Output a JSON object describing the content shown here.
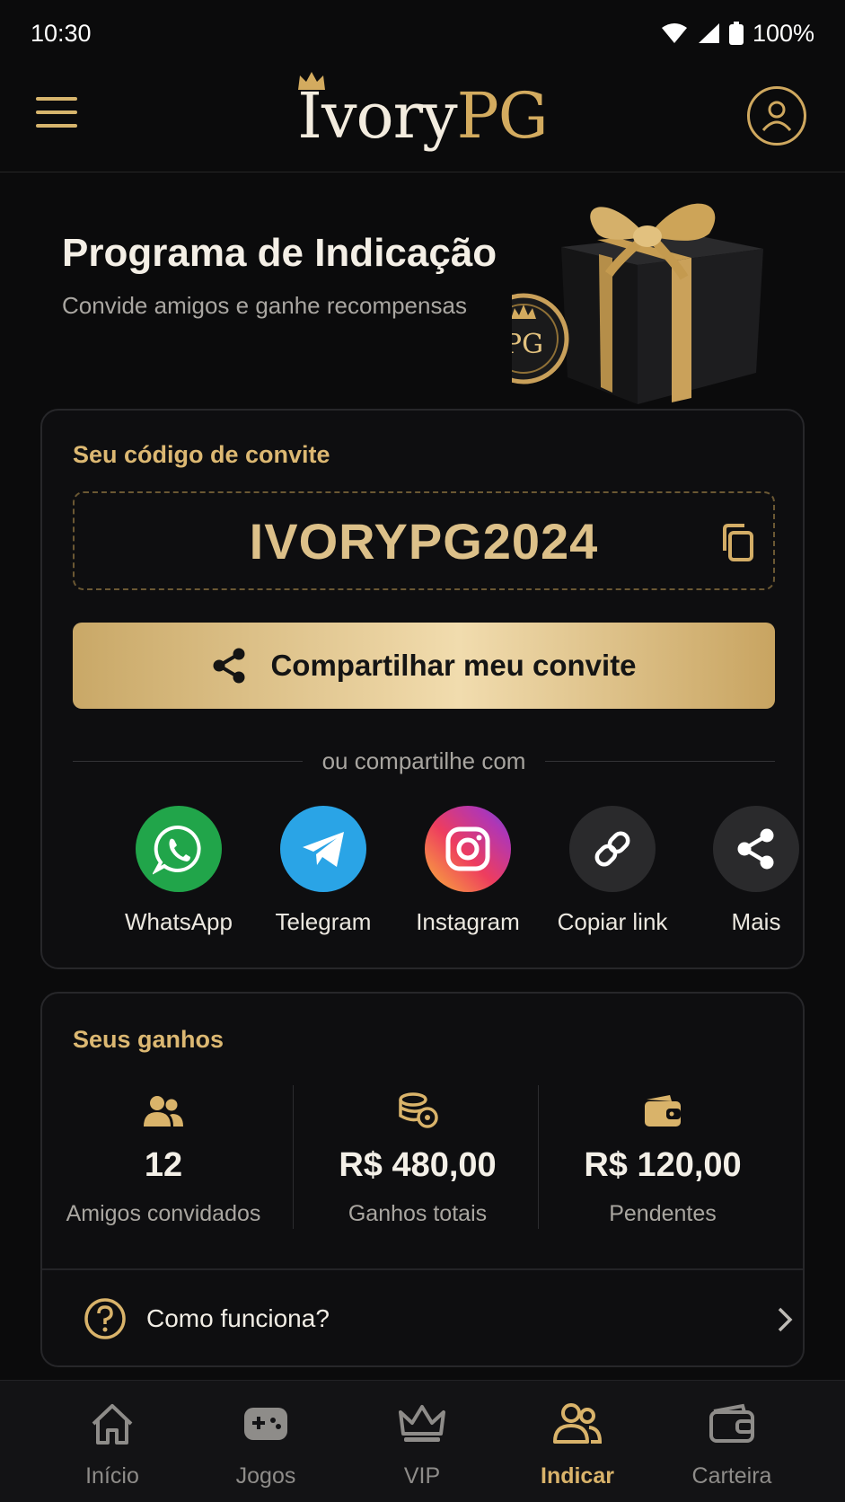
{
  "status_bar": {
    "time": "10:30",
    "battery": "100%"
  },
  "header": {
    "logo_main": "Ivory",
    "logo_accent": "PG"
  },
  "hero": {
    "title": "Programa de Indicação",
    "subtitle": "Convide amigos e ganhe recompensas",
    "badge_text": "PG"
  },
  "invite": {
    "label": "Seu código de convite",
    "code": "IVORYPG2024",
    "share_button": "Compartilhar meu convite",
    "divider_text": "ou compartilhe com",
    "share_options": [
      {
        "label": "WhatsApp",
        "icon": "whatsapp-icon",
        "color": "#21a54a"
      },
      {
        "label": "Telegram",
        "icon": "telegram-icon",
        "color": "#2aa4e6"
      },
      {
        "label": "Instagram",
        "icon": "instagram-icon",
        "color": "#d6337a"
      },
      {
        "label": "Copiar link",
        "icon": "link-icon",
        "color": "#2a2a2c"
      },
      {
        "label": "Mais",
        "icon": "share-icon",
        "color": "#2a2a2c"
      }
    ]
  },
  "earnings": {
    "label": "Seus ganhos",
    "stats": [
      {
        "value": "12",
        "caption": "Amigos convidados",
        "icon": "users-icon"
      },
      {
        "value": "R$ 480,00",
        "caption": "Ganhos totais",
        "icon": "coins-icon"
      },
      {
        "value": "R$ 120,00",
        "caption": "Pendentes",
        "icon": "wallet-icon"
      }
    ],
    "how_it_works": "Como funciona?"
  },
  "nav": [
    {
      "label": "Início",
      "icon": "home-icon",
      "active": false
    },
    {
      "label": "Jogos",
      "icon": "gamepad-icon",
      "active": false
    },
    {
      "label": "VIP",
      "icon": "crown-icon",
      "active": false
    },
    {
      "label": "Indicar",
      "icon": "referral-icon",
      "active": true
    },
    {
      "label": "Carteira",
      "icon": "wallet-icon",
      "active": false
    }
  ],
  "colors": {
    "gold": "#d9b36a",
    "background": "#0b0b0c",
    "card": "#0e0e10"
  }
}
